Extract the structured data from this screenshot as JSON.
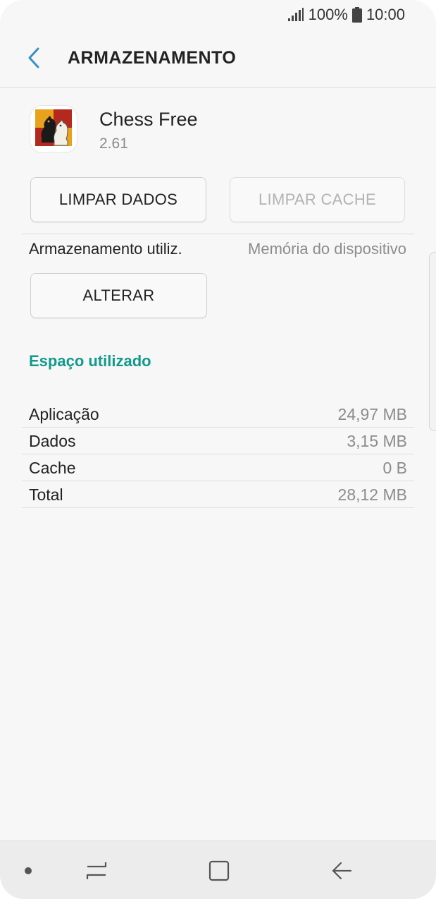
{
  "status_bar": {
    "battery_percent": "100%",
    "time": "10:00",
    "icons": [
      "signal-icon",
      "battery-icon"
    ]
  },
  "header": {
    "title": "ARMAZENAMENTO",
    "back_icon": "back-arrow-icon"
  },
  "app": {
    "name": "Chess Free",
    "version": "2.61",
    "icon": "chess-knight-icon"
  },
  "buttons": {
    "clear_data": "LIMPAR DADOS",
    "clear_cache": "LIMPAR CACHE",
    "change": "ALTERAR"
  },
  "storage_used": {
    "label": "Armazenamento utiliz.",
    "value": "Memória do dispositivo"
  },
  "usage": {
    "title": "Espaço utilizado",
    "rows": [
      {
        "label": "Aplicação",
        "value": "24,97 MB"
      },
      {
        "label": "Dados",
        "value": "3,15 MB"
      },
      {
        "label": "Cache",
        "value": "0 B"
      },
      {
        "label": "Total",
        "value": "28,12 MB"
      }
    ]
  },
  "colors": {
    "accent": "#129a8c",
    "back_arrow": "#3a8fc4",
    "disabled_text": "#b3b3b3",
    "secondary_text": "#8c8c8c"
  },
  "nav_bar": {
    "icons": [
      "dot-indicator-icon",
      "recent-apps-icon",
      "home-icon",
      "back-icon"
    ]
  }
}
